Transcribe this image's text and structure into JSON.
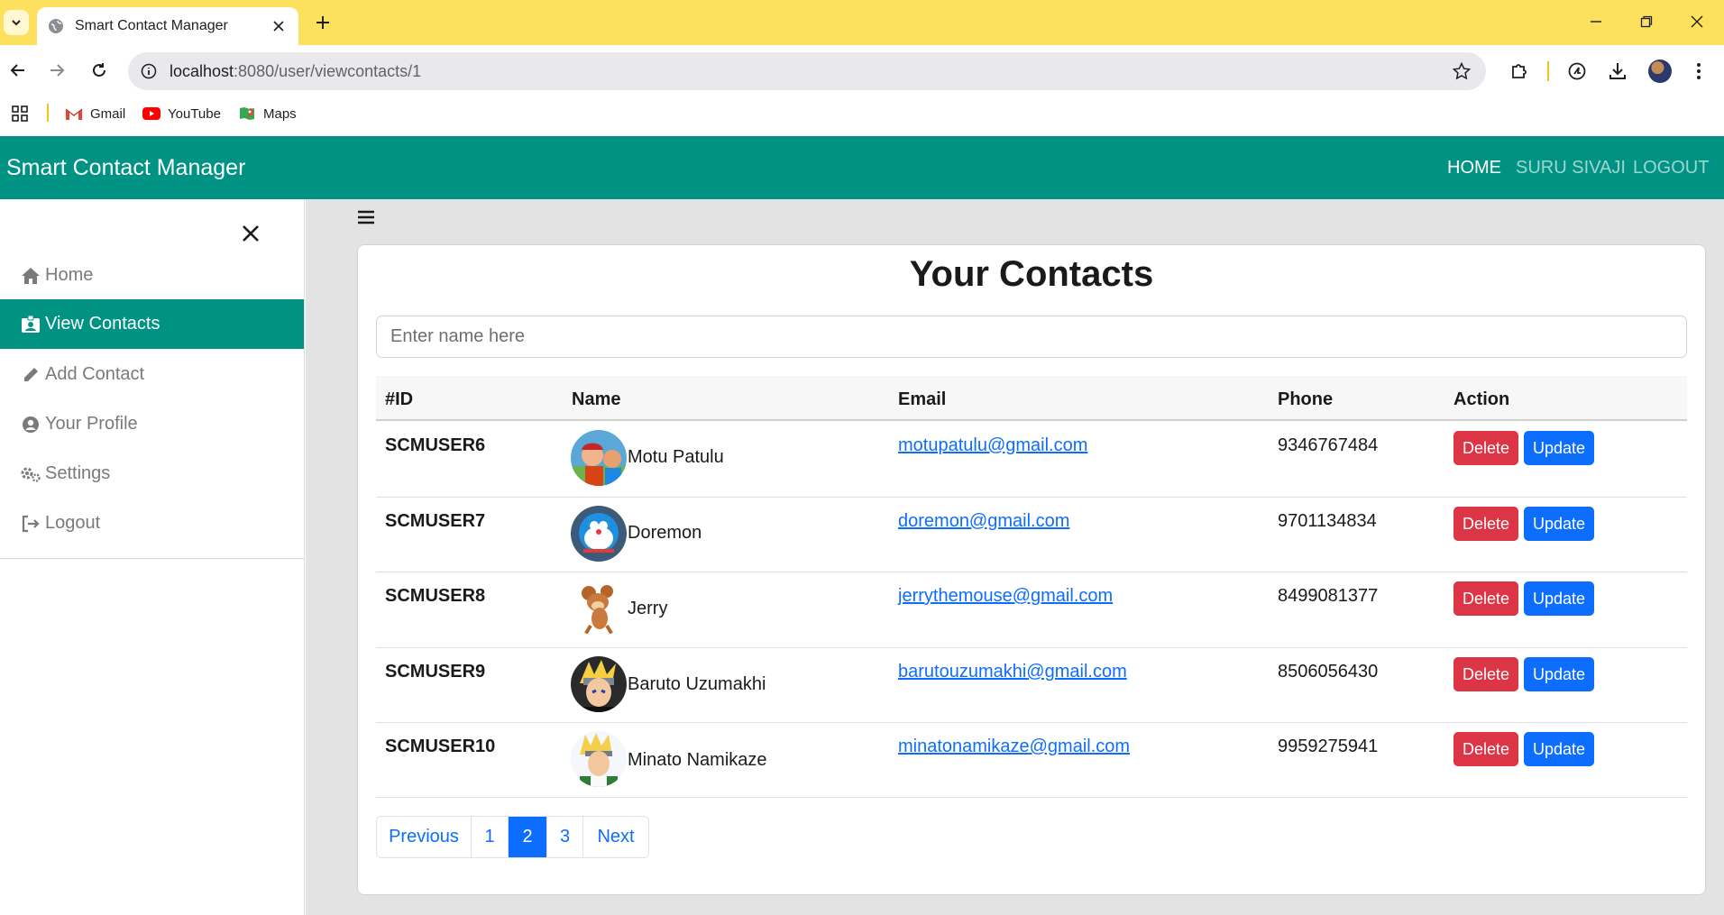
{
  "browser": {
    "tab_title": "Smart Contact Manager",
    "url_host": "localhost",
    "url_path": ":8080/user/viewcontacts/1",
    "bookmarks": [
      {
        "label": "Gmail"
      },
      {
        "label": "YouTube"
      },
      {
        "label": "Maps"
      }
    ]
  },
  "app": {
    "brand": "Smart Contact Manager",
    "nav": {
      "home": "HOME",
      "user": "SURU SIVAJI",
      "logout": "LOGOUT"
    }
  },
  "sidebar": {
    "items": [
      {
        "label": "Home",
        "icon": "home-icon"
      },
      {
        "label": "View Contacts",
        "icon": "contact-card-icon",
        "active": true
      },
      {
        "label": "Add Contact",
        "icon": "pencil-icon"
      },
      {
        "label": "Your Profile",
        "icon": "user-circle-icon"
      },
      {
        "label": "Settings",
        "icon": "gears-icon"
      },
      {
        "label": "Logout",
        "icon": "logout-icon"
      }
    ]
  },
  "main": {
    "title": "Your Contacts",
    "search_placeholder": "Enter name here",
    "columns": [
      "#ID",
      "Name",
      "Email",
      "Phone",
      "Action"
    ],
    "rows": [
      {
        "id": "SCMUSER6",
        "name": "Motu Patulu",
        "email": "motupatulu@gmail.com",
        "phone": "9346767484"
      },
      {
        "id": "SCMUSER7",
        "name": "Doremon",
        "email": "doremon@gmail.com",
        "phone": "9701134834"
      },
      {
        "id": "SCMUSER8",
        "name": "Jerry",
        "email": "jerrythemouse@gmail.com",
        "phone": "8499081377"
      },
      {
        "id": "SCMUSER9",
        "name": "Baruto Uzumakhi",
        "email": "barutouzumakhi@gmail.com",
        "phone": "8506056430"
      },
      {
        "id": "SCMUSER10",
        "name": "Minato Namikaze",
        "email": "minatonamikaze@gmail.com",
        "phone": "9959275941"
      }
    ],
    "delete_label": "Delete",
    "update_label": "Update",
    "pagination": {
      "previous": "Previous",
      "pages": [
        "1",
        "2",
        "3"
      ],
      "active": "2",
      "next": "Next"
    }
  },
  "colors": {
    "accent": "#009384",
    "danger": "#dc3545",
    "primary": "#0d6efd",
    "tabbar": "#fde15e"
  }
}
